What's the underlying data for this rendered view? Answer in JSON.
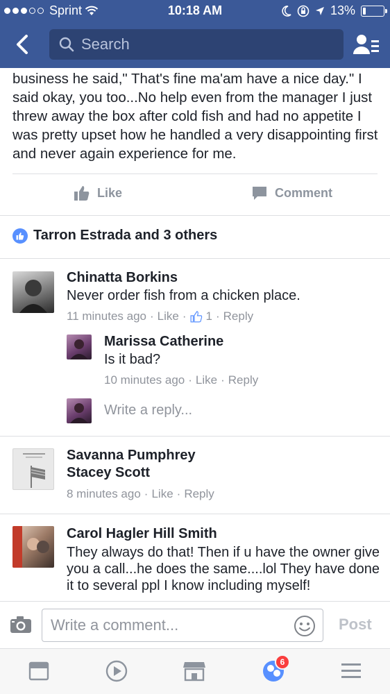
{
  "status_bar": {
    "carrier": "Sprint",
    "time": "10:18 AM",
    "battery": "13%",
    "battery_level": 0.13
  },
  "nav": {
    "back_icon": "chevron-left-icon",
    "search_placeholder": "Search",
    "friends_icon": "friends-list-icon"
  },
  "post": {
    "text": "business he said,\" That's fine ma'am have a nice day.\" I said okay, you too...No help even from the manager I just threw away the box after cold fish and had no appetite I was pretty upset how he handled a very disappointing first and never again experience for me.",
    "like_label": "Like",
    "comment_label": "Comment",
    "likers": "Tarron Estrada and 3 others"
  },
  "comments": [
    {
      "name": "Chinatta Borkins",
      "text": "Never order fish from a chicken place.",
      "time": "11 minutes ago",
      "like_label": "Like",
      "like_count": "1",
      "reply_label": "Reply",
      "replies": [
        {
          "name": "Marissa Catherine",
          "text": "Is it bad?",
          "time": "10 minutes ago",
          "like_label": "Like",
          "reply_label": "Reply"
        }
      ],
      "write_reply": "Write a reply..."
    },
    {
      "name": "Savanna Pumphrey",
      "tagged": "Stacey Scott",
      "time": "8 minutes ago",
      "like_label": "Like",
      "reply_label": "Reply"
    },
    {
      "name": "Carol Hagler Hill Smith",
      "text": "They always do that! Then if u have the owner give you a call...he does the same....lol They have done it to several ppl I know including myself!"
    }
  ],
  "composer": {
    "placeholder": "Write a comment...",
    "post_label": "Post"
  },
  "tabbar": {
    "notification_count": "6",
    "tabs": [
      "news-feed-icon",
      "video-icon",
      "marketplace-icon",
      "notifications-icon",
      "menu-icon"
    ]
  },
  "colors": {
    "brand": "#3b5998",
    "search_bg": "#2d4373",
    "like_blue": "#5890ff",
    "meta_gray": "#90949c",
    "badge_red": "#fa3e3e"
  }
}
